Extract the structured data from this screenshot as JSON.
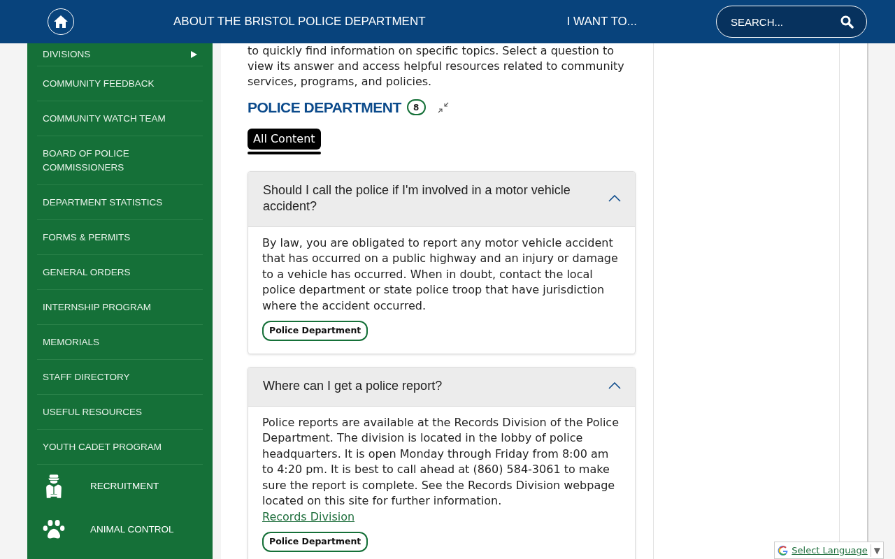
{
  "header": {
    "nav_links": [
      "ABOUT THE BRISTOL POLICE DEPARTMENT",
      "I WANT TO..."
    ],
    "search": {
      "placeholder": "SEARCH..."
    }
  },
  "sidebar": {
    "items": [
      {
        "label": "DIVISIONS",
        "kind": "submenu"
      },
      {
        "label": "COMMUNITY FEEDBACK",
        "kind": "link"
      },
      {
        "label": "COMMUNITY WATCH TEAM",
        "kind": "link"
      },
      {
        "label": "BOARD OF POLICE COMMISSIONERS",
        "kind": "link"
      },
      {
        "label": "DEPARTMENT STATISTICS",
        "kind": "link"
      },
      {
        "label": "FORMS & PERMITS",
        "kind": "link"
      },
      {
        "label": "GENERAL ORDERS",
        "kind": "link"
      },
      {
        "label": "INTERNSHIP PROGRAM",
        "kind": "link"
      },
      {
        "label": "MEMORIALS",
        "kind": "link"
      },
      {
        "label": "STAFF DIRECTORY",
        "kind": "link"
      },
      {
        "label": "USEFUL RESOURCES",
        "kind": "link"
      },
      {
        "label": "YOUTH CADET PROGRAM",
        "kind": "link"
      }
    ],
    "featured_links": [
      {
        "label": "RECRUITMENT"
      },
      {
        "label": "ANIMAL CONTROL"
      }
    ]
  },
  "main": {
    "intro": "to quickly find information on specific topics. Select a question to view its answer and access helpful resources related to community services, programs, and policies.",
    "category": {
      "title": "POLICE DEPARTMENT",
      "count": "8"
    },
    "tabs": [
      {
        "label": "All Content",
        "selected": true
      }
    ],
    "faqs": [
      {
        "question": "Should I call the police if I'm involved in a motor vehicle accident?",
        "expanded": true,
        "answer": "By law, you are obligated to report any motor vehicle accident that has occurred on a public highway and an injury or damage to a vehicle has occurred. When in doubt, contact the local police department or state police troop that have jurisdiction where the accident occurred.",
        "tags": [
          "Police Department"
        ]
      },
      {
        "question": "Where can I get a police report?",
        "expanded": true,
        "answer": "Police reports are available at the Records Division of the Police Department. The division is located in the lobby of police headquarters. It is open Monday through Friday from 8:00 am to 4:20 pm. It is best to call ahead at (860) 584-3061 to make sure the report is complete. See the Records Division webpage located on this site for further information.",
        "link": "Records Division",
        "tags": [
          "Police Department"
        ]
      }
    ]
  },
  "language_widget": {
    "label": "Select Language",
    "arrow": "▼"
  }
}
